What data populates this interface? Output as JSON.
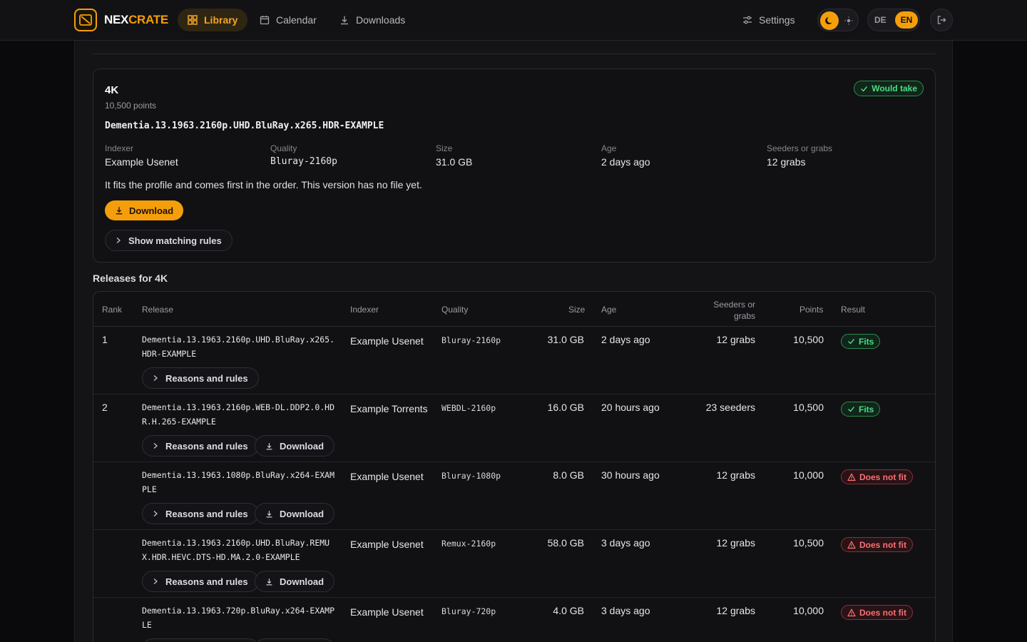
{
  "nav": {
    "brand_a": "NEX",
    "brand_b": "CRATE",
    "library": "Library",
    "calendar": "Calendar",
    "downloads": "Downloads",
    "settings": "Settings",
    "lang_de": "DE",
    "lang_en": "EN",
    "theme": "dark"
  },
  "card": {
    "title": "4K",
    "points": "10,500 points",
    "release": "Dementia.13.1963.2160p.UHD.BluRay.x265.HDR-EXAMPLE",
    "status": "Would take",
    "meta": [
      {
        "label": "Indexer",
        "value": "Example Usenet"
      },
      {
        "label": "Quality",
        "value": "Bluray-2160p"
      },
      {
        "label": "Size",
        "value": "31.0 GB"
      },
      {
        "label": "Age",
        "value": "2 days ago"
      },
      {
        "label": "Seeders or grabs",
        "value": "12 grabs"
      }
    ],
    "description": "It fits the profile and comes first in the order. This version has no file yet.",
    "download_label": "Download",
    "rules_label": "Show matching rules"
  },
  "releases": {
    "title": "Releases for 4K",
    "headers": {
      "rank": "Rank",
      "release": "Release",
      "indexer": "Indexer",
      "quality": "Quality",
      "size": "Size",
      "age": "Age",
      "seeders_1": "Seeders or",
      "seeders_2": "grabs",
      "points": "Points",
      "result": "Result"
    },
    "reasons_label": "Reasons and rules",
    "download_label": "Download",
    "rows": [
      {
        "rank": "1",
        "release": "Dementia.13.1963.2160p.UHD.BluRay.x265.HDR-EXAMPLE",
        "indexer": "Example Usenet",
        "quality": "Bluray-2160p",
        "size": "31.0 GB",
        "age": "2 days ago",
        "seeders": "12 grabs",
        "points": "10,500",
        "result": "Fits"
      },
      {
        "rank": "2",
        "release": "Dementia.13.1963.2160p.WEB-DL.DDP2.0.HDR.H.265-EXAMPLE",
        "indexer": "Example Torrents",
        "quality": "WEBDL-2160p",
        "size": "16.0 GB",
        "age": "20 hours ago",
        "seeders": "23 seeders",
        "points": "10,500",
        "result": "Fits"
      },
      {
        "rank": "",
        "release": "Dementia.13.1963.1080p.BluRay.x264-EXAMPLE",
        "indexer": "Example Usenet",
        "quality": "Bluray-1080p",
        "size": "8.0 GB",
        "age": "30 hours ago",
        "seeders": "12 grabs",
        "points": "10,000",
        "result": "Does not fit"
      },
      {
        "rank": "",
        "release": "Dementia.13.1963.2160p.UHD.BluRay.REMUX.HDR.HEVC.DTS-HD.MA.2.0-EXAMPLE",
        "indexer": "Example Usenet",
        "quality": "Remux-2160p",
        "size": "58.0 GB",
        "age": "3 days ago",
        "seeders": "12 grabs",
        "points": "10,500",
        "result": "Does not fit"
      },
      {
        "rank": "",
        "release": "Dementia.13.1963.720p.BluRay.x264-EXAMPLE",
        "indexer": "Example Usenet",
        "quality": "Bluray-720p",
        "size": "4.0 GB",
        "age": "3 days ago",
        "seeders": "12 grabs",
        "points": "10,000",
        "result": "Does not fit"
      }
    ]
  },
  "colors": {
    "accent": "#f59e0b",
    "fits": "#4ade80",
    "does_not_fit": "#f87171"
  }
}
